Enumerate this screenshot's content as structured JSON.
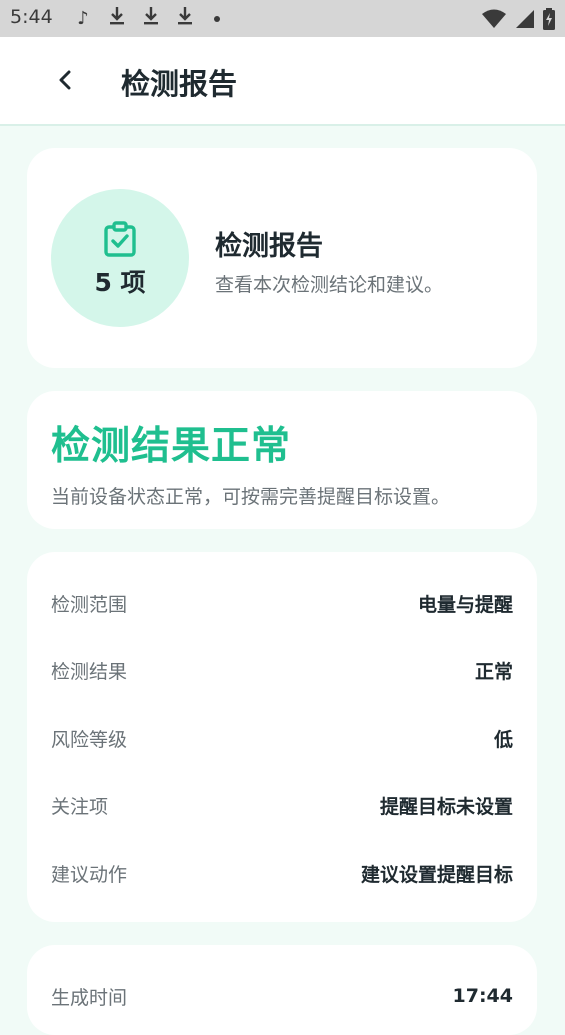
{
  "status_bar": {
    "time": "5:44",
    "left_icons": [
      "tiktok-icon",
      "download-icon",
      "download-icon",
      "download-icon",
      "dot-icon"
    ],
    "right_icons": [
      "wifi-icon",
      "signal-icon",
      "battery-icon"
    ]
  },
  "header": {
    "title": "检测报告",
    "back_icon": "chevron-left-icon"
  },
  "summary": {
    "icon": "clipboard-check-icon",
    "count": "5 项",
    "title": "检测报告",
    "subtitle": "查看本次检测结论和建议。"
  },
  "result": {
    "title": "检测结果正常",
    "description": "当前设备状态正常，可按需完善提醒目标设置。"
  },
  "details": [
    {
      "label": "检测范围",
      "value": "电量与提醒"
    },
    {
      "label": "检测结果",
      "value": "正常"
    },
    {
      "label": "风险等级",
      "value": "低"
    },
    {
      "label": "关注项",
      "value": "提醒目标未设置"
    },
    {
      "label": "建议动作",
      "value": "建议设置提醒目标"
    }
  ],
  "meta": {
    "label": "生成时间",
    "value": "17:44"
  },
  "colors": {
    "accent": "#1fbf8f",
    "page_bg": "#f1fbf7",
    "circle_bg": "#d4f6ea"
  }
}
